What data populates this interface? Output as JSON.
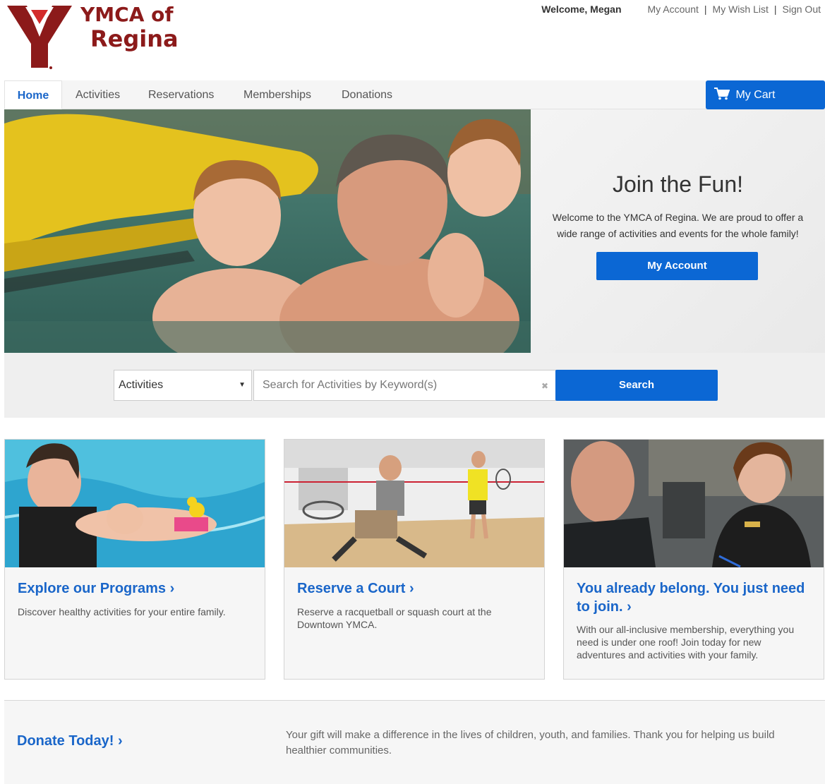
{
  "brand": {
    "line1": "YMCA of",
    "line2": "Regina",
    "color": "#8c1a1a"
  },
  "header": {
    "welcome": "Welcome, Megan",
    "links": [
      "My Account",
      "My Wish List",
      "Sign Out"
    ],
    "separator": "|"
  },
  "nav": {
    "tabs": [
      "Home",
      "Activities",
      "Reservations",
      "Memberships",
      "Donations"
    ],
    "active": "Home",
    "cart_label": "My Cart",
    "cart_icon": "cart-icon"
  },
  "hero": {
    "title": "Join the Fun!",
    "text": "Welcome to the YMCA of Regina. We are proud to offer a wide range of activities and events for the whole family!",
    "button": "My Account"
  },
  "search": {
    "category": "Activities",
    "placeholder": "Search for Activities by Keyword(s)",
    "clear": "✖",
    "button": "Search"
  },
  "cards": [
    {
      "title": "Explore our Programs",
      "text": "Discover healthy activities for your entire family."
    },
    {
      "title": "Reserve a Court",
      "text": "Reserve a racquetball or squash court at the Downtown YMCA."
    },
    {
      "title": "You already belong. You just need to join.",
      "text": "With our all-inclusive membership, everything you need is under one roof! Join today for new adventures and activities with your family."
    }
  ],
  "donate": {
    "title": "Donate Today!",
    "text": "Your gift will make a difference in the lives of children, youth, and families. Thank you for helping us build healthier communities."
  },
  "colors": {
    "primary": "#0b67d4",
    "link": "#1a66c9"
  }
}
